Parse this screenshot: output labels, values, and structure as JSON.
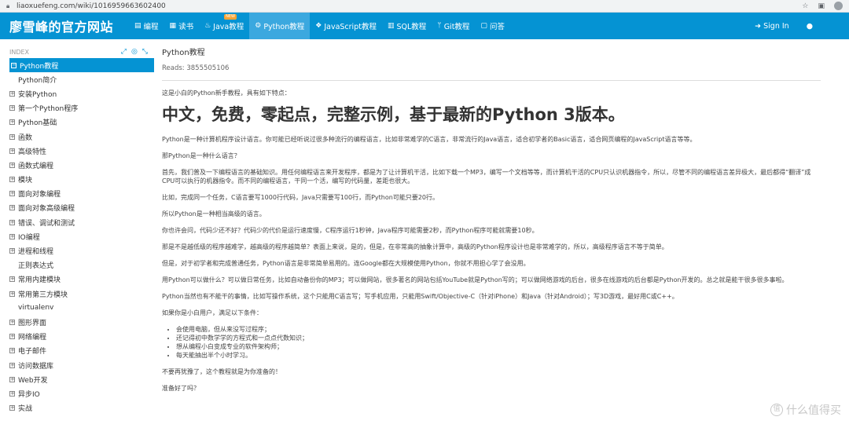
{
  "browser": {
    "url": "liaoxuefeng.com/wiki/1016959663602400"
  },
  "nav": {
    "brand": "廖雪峰的官方网站",
    "items": [
      {
        "label": "编程",
        "icon": "book-icon"
      },
      {
        "label": "读书",
        "icon": "document-icon"
      },
      {
        "label": "Java教程",
        "icon": "coffee-icon",
        "badge": "NEW"
      },
      {
        "label": "Python教程",
        "icon": "python-icon",
        "active": true
      },
      {
        "label": "JavaScript教程",
        "icon": "js-icon"
      },
      {
        "label": "SQL教程",
        "icon": "database-icon"
      },
      {
        "label": "Git教程",
        "icon": "git-icon"
      },
      {
        "label": "问答",
        "icon": "chat-icon"
      }
    ],
    "signin": "Sign In"
  },
  "sidebar": {
    "index_label": "INDEX",
    "items": [
      {
        "label": "Python教程",
        "exp": "minus",
        "active": true
      },
      {
        "label": "Python简介",
        "exp": "none"
      },
      {
        "label": "安装Python",
        "exp": "plus"
      },
      {
        "label": "第一个Python程序",
        "exp": "plus"
      },
      {
        "label": "Python基础",
        "exp": "plus"
      },
      {
        "label": "函数",
        "exp": "plus"
      },
      {
        "label": "高级特性",
        "exp": "plus"
      },
      {
        "label": "函数式编程",
        "exp": "plus"
      },
      {
        "label": "模块",
        "exp": "plus"
      },
      {
        "label": "面向对象编程",
        "exp": "plus"
      },
      {
        "label": "面向对象高级编程",
        "exp": "plus"
      },
      {
        "label": "错误、调试和测试",
        "exp": "plus"
      },
      {
        "label": "IO编程",
        "exp": "plus"
      },
      {
        "label": "进程和线程",
        "exp": "plus"
      },
      {
        "label": "正则表达式",
        "exp": "none"
      },
      {
        "label": "常用内建模块",
        "exp": "plus"
      },
      {
        "label": "常用第三方模块",
        "exp": "plus"
      },
      {
        "label": "virtualenv",
        "exp": "none"
      },
      {
        "label": "图形界面",
        "exp": "plus"
      },
      {
        "label": "网络编程",
        "exp": "plus"
      },
      {
        "label": "电子邮件",
        "exp": "plus"
      },
      {
        "label": "访问数据库",
        "exp": "plus"
      },
      {
        "label": "Web开发",
        "exp": "plus"
      },
      {
        "label": "异步IO",
        "exp": "plus"
      },
      {
        "label": "实战",
        "exp": "plus"
      }
    ]
  },
  "article": {
    "title": "Python教程",
    "reads": "Reads: 3855505106",
    "intro": "这是小白的Python新手教程，具有如下特点：",
    "headline": "中文，免费，零起点，完整示例，基于最新的Python 3版本。",
    "p1": "Python是一种计算机程序设计语言。你可能已经听说过很多种流行的编程语言，比如非常难学的C语言，非常流行的Java语言，适合初学者的Basic语言，适合网页编程的JavaScript语言等等。",
    "p2": "那Python是一种什么语言？",
    "p3": "首先，我们普及一下编程语言的基础知识。用任何编程语言来开发程序，都是为了让计算机干活，比如下载一个MP3，编写一个文档等等，而计算机干活的CPU只认识机器指令，所以，尽管不同的编程语言差异极大，最后都得“翻译”成CPU可以执行的机器指令。而不同的编程语言，干同一个活，编写的代码量，差距也很大。",
    "p4": "比如，完成同一个任务，C语言要写1000行代码，Java只需要写100行，而Python可能只要20行。",
    "p5": "所以Python是一种相当高级的语言。",
    "p6": "你也许会问，代码少还不好？代码少的代价是运行速度慢，C程序运行1秒钟，Java程序可能需要2秒，而Python程序可能就需要10秒。",
    "p7": "那是不是越低级的程序越难学，越高级的程序越简单？表面上来说，是的，但是，在非常高的抽象计算中，高级的Python程序设计也是非常难学的，所以，高级程序语言不等于简单。",
    "p8": "但是，对于初学者和完成普通任务，Python语言是非常简单易用的。连Google都在大规模使用Python，你就不用担心学了会没用。",
    "p9": "用Python可以做什么？可以做日常任务，比如自动备份你的MP3；可以做网站，很多著名的网站包括YouTube就是Python写的；可以做网络游戏的后台，很多在线游戏的后台都是Python开发的。总之就是能干很多很多事啦。",
    "p10": "Python当然也有不能干的事情，比如写操作系统，这个只能用C语言写；写手机应用，只能用Swift/Objective-C（针对iPhone）和Java（针对Android）；写3D游戏，最好用C或C++。",
    "p11": "如果你是小白用户，满足以下条件：",
    "list": [
      "会使用电脑，但从来没写过程序；",
      "还记得初中数学学的方程式和一点点代数知识；",
      "想从编程小白变成专业的软件架构师；",
      "每天能抽出半个小时学习。"
    ],
    "p12": "不要再犹豫了，这个教程就是为你准备的！",
    "p13": "准备好了吗？"
  },
  "watermark": {
    "text": "什么值得买",
    "mark": "值"
  }
}
